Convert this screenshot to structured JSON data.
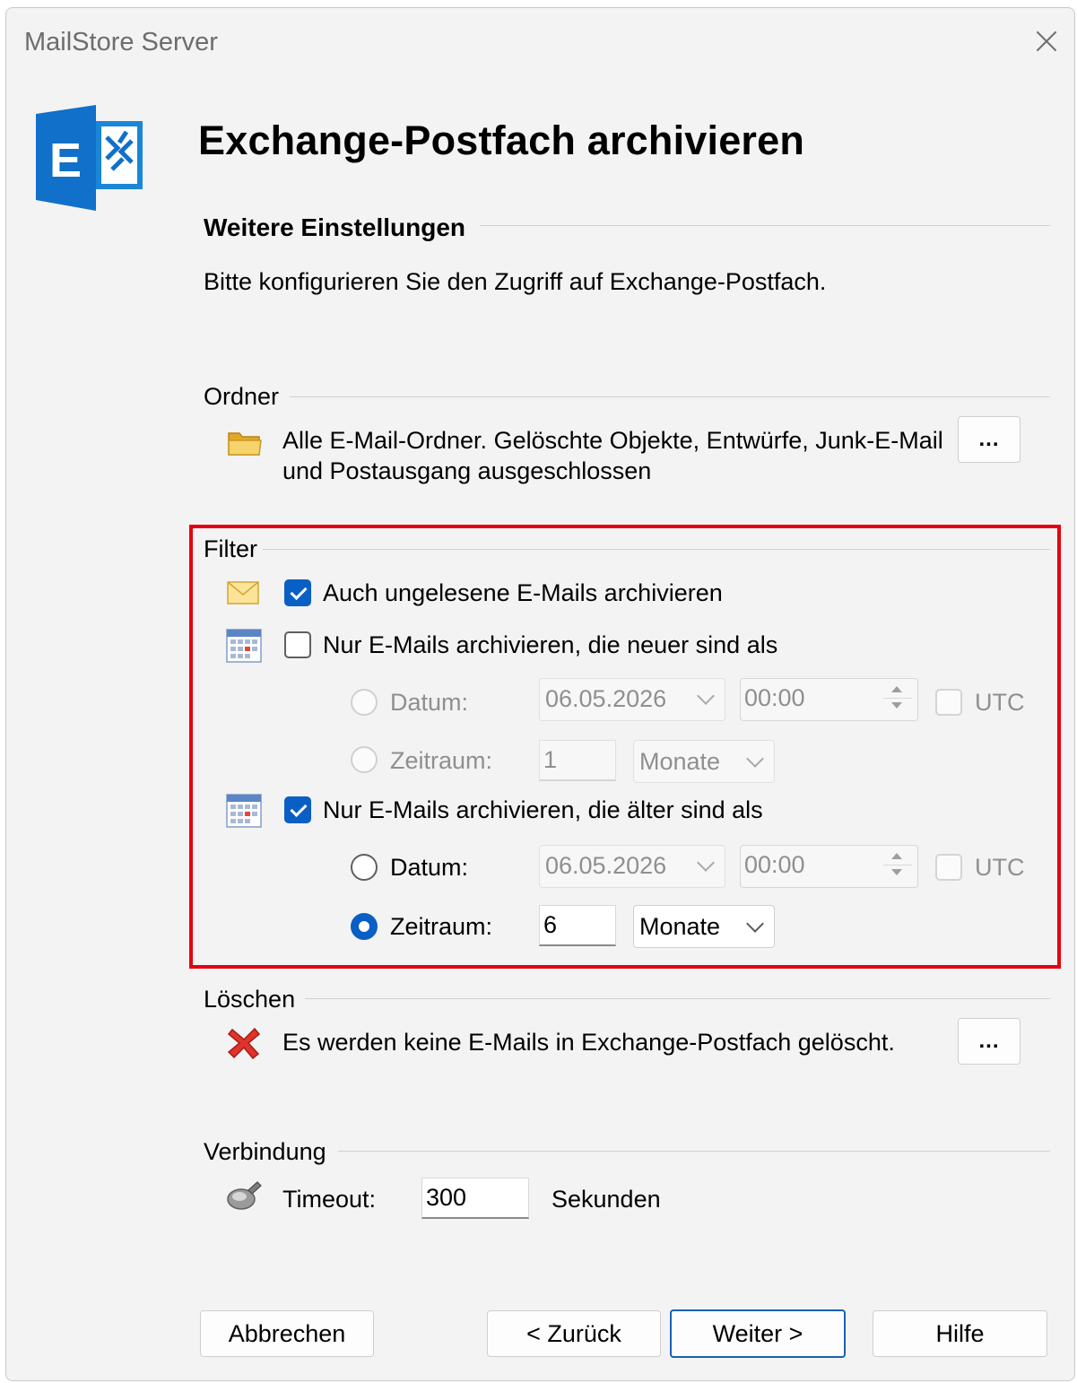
{
  "window": {
    "title": "MailStore Server"
  },
  "header": {
    "logo_icon": "exchange-logo-icon",
    "title": "Exchange-Postfach archivieren",
    "subtitle": "Weitere Einstellungen",
    "description": "Bitte konfigurieren Sie den Zugriff auf Exchange-Postfach."
  },
  "folders": {
    "section_label": "Ordner",
    "icon": "folder-icon",
    "text_line1": "Alle E-Mail-Ordner. Gelöschte Objekte, Entwürfe, Junk-E-Mail",
    "text_line2": "und Postausgang ausgeschlossen",
    "button_label": "..."
  },
  "filter": {
    "section_label": "Filter",
    "highlight_color": "#e4000f",
    "unread": {
      "icon": "envelope-icon",
      "label": "Auch ungelesene E-Mails archivieren",
      "checked": true
    },
    "newer": {
      "icon": "calendar-icon",
      "label": "Nur E-Mails archivieren, die neuer sind als",
      "checked": false,
      "enabled": false,
      "date_label": "Datum:",
      "date_value": "06.05.2026",
      "time_value": "00:00",
      "utc_label": "UTC",
      "utc_checked": false,
      "period_label": "Zeitraum:",
      "period_value": "1",
      "period_unit": "Monate",
      "selected_option": "none"
    },
    "older": {
      "icon": "calendar-icon",
      "label": "Nur E-Mails archivieren, die älter sind als",
      "checked": true,
      "enabled": true,
      "date_label": "Datum:",
      "date_value": "06.05.2026",
      "time_value": "00:00",
      "utc_label": "UTC",
      "utc_checked": false,
      "period_label": "Zeitraum:",
      "period_value": "6",
      "period_unit": "Monate",
      "selected_option": "Zeitraum"
    }
  },
  "delete": {
    "section_label": "Löschen",
    "icon": "red-x-icon",
    "text": "Es werden keine E-Mails in Exchange-Postfach gelöscht.",
    "button_label": "..."
  },
  "connection": {
    "section_label": "Verbindung",
    "icon": "network-icon",
    "timeout_label": "Timeout:",
    "timeout_value": "300",
    "unit_label": "Sekunden"
  },
  "footer": {
    "cancel_label": "Abbrechen",
    "back_label": "< Zurück",
    "next_label": "Weiter >",
    "help_label": "Hilfe"
  },
  "colors": {
    "accent": "#0a5fc4",
    "exchange_blue": "#1170c9"
  }
}
